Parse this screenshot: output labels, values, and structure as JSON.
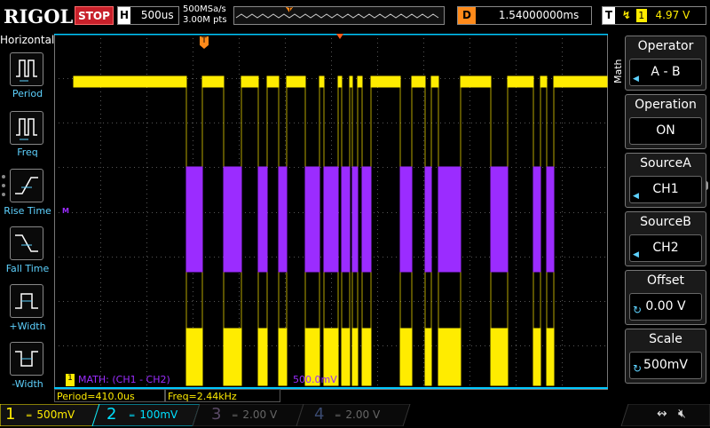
{
  "header": {
    "logo": "RIGOL",
    "run_state": "STOP",
    "timebase_label": "H",
    "timebase": "500us",
    "sample_rate": "500MSa/s",
    "memory_depth": "3.00M pts",
    "delay_label": "D",
    "delay": "1.54000000ms",
    "trigger_label": "T",
    "trigger_source": "1",
    "trigger_level": "4.97 V",
    "trigger_marker": "T"
  },
  "left_panel": {
    "title": "Horizontal",
    "items": [
      {
        "label": "Period",
        "icon": "period-icon"
      },
      {
        "label": "Freq",
        "icon": "freq-icon"
      },
      {
        "label": "Rise Time",
        "icon": "rise-time-icon"
      },
      {
        "label": "Fall Time",
        "icon": "fall-time-icon"
      },
      {
        "label": "+Width",
        "icon": "pos-width-icon"
      },
      {
        "label": "-Width",
        "icon": "neg-width-icon"
      }
    ]
  },
  "right_panel": {
    "tab": "Math",
    "menus": [
      {
        "title": "Operator",
        "value": "A - B"
      },
      {
        "title": "Operation",
        "value": "ON"
      },
      {
        "title": "SourceA",
        "value": "CH1"
      },
      {
        "title": "SourceB",
        "value": "CH2"
      },
      {
        "title": "Offset",
        "value": "0.00 V"
      },
      {
        "title": "Scale",
        "value": "500mV"
      }
    ]
  },
  "waveform": {
    "math_marker": "M",
    "math_label": "MATH: (CH1 - CH2)",
    "math_scale": "500.0mV",
    "ch1_marker": "1"
  },
  "measurements": {
    "period": "Period=410.0us",
    "freq": "Freq=2.44kHz"
  },
  "channels": [
    {
      "num": "1",
      "scale": "500mV",
      "color": "#ffec00",
      "active": true
    },
    {
      "num": "2",
      "scale": "100mV",
      "color": "#00e0ff",
      "active": true
    },
    {
      "num": "3",
      "scale": "2.00 V",
      "color": "#c040ff",
      "active": false
    },
    {
      "num": "4",
      "scale": "2.00 V",
      "color": "#3c6cff",
      "active": false
    }
  ],
  "colors": {
    "ch1": "#ffec00",
    "math": "#9b2cff",
    "accent": "#5ed2ff"
  }
}
